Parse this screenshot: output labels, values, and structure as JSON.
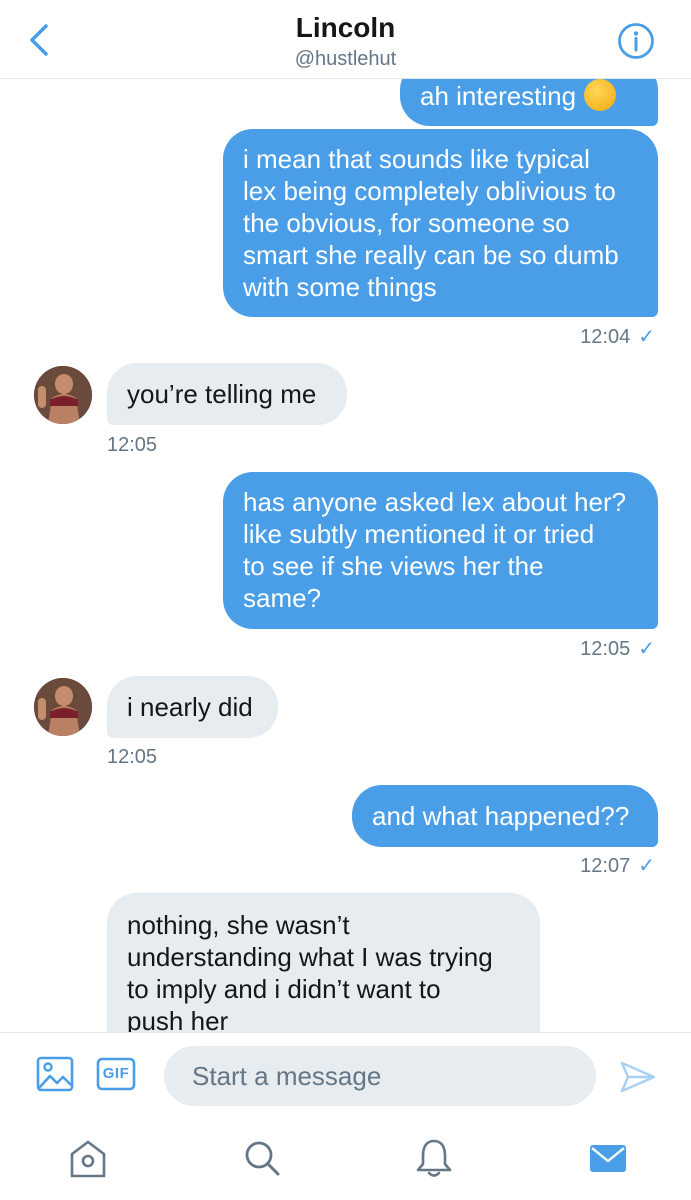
{
  "header": {
    "title": "Lincoln",
    "handle": "@hustlehut"
  },
  "messages": [
    {
      "direction": "out",
      "text": "ah interesting",
      "emoji": "thinking-face"
    },
    {
      "direction": "out",
      "lines": [
        "i mean that sounds like typical",
        "lex being completely oblivious to",
        "the obvious, for someone so",
        "smart she really can be so dumb",
        "with some things"
      ],
      "time": "12:04"
    },
    {
      "direction": "in",
      "text": "you’re telling me",
      "time": "12:05"
    },
    {
      "direction": "out",
      "lines": [
        "has anyone asked lex about her?",
        "like subtly mentioned it or tried",
        "to see if she views her the",
        "same?"
      ],
      "time": "12:05"
    },
    {
      "direction": "in",
      "text": "i nearly did",
      "time": "12:05"
    },
    {
      "direction": "out",
      "text": "and what happened??",
      "time": "12:07"
    },
    {
      "direction": "in",
      "lines": [
        "nothing, she wasn’t",
        "understanding what I was trying",
        "to imply and i didn’t want to",
        "push her"
      ]
    }
  ],
  "composer": {
    "placeholder": "Start a message",
    "gif_label": "GIF"
  },
  "colors": {
    "accent": "#4a9ee8",
    "incoming_bubble": "#e6ecf0",
    "secondary_text": "#657786"
  },
  "icons": [
    "back-chevron-icon",
    "info-icon",
    "image-icon",
    "gif-icon",
    "send-icon",
    "home-icon",
    "search-icon",
    "notifications-bell-icon",
    "messages-envelope-icon"
  ]
}
